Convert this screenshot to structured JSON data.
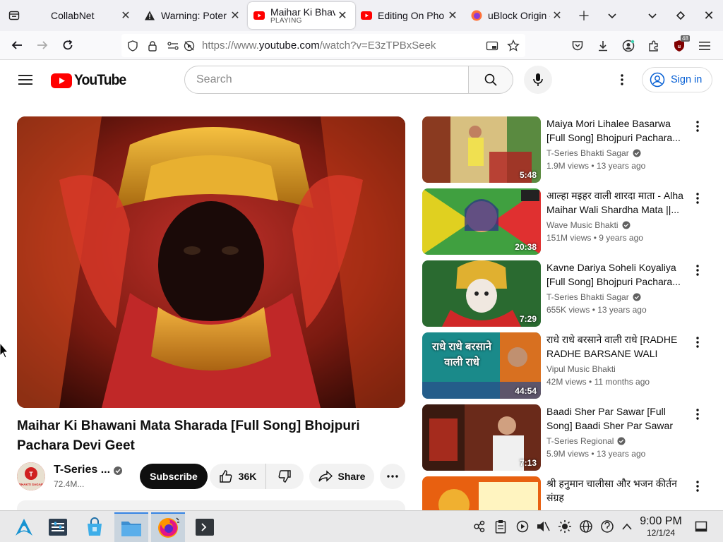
{
  "browser": {
    "tabs": [
      {
        "title": "CollabNet",
        "favicon": "blank-page-icon"
      },
      {
        "title": "Warning: Poter",
        "favicon": "warning-icon"
      },
      {
        "title": "Maihar Ki Bhav",
        "subtitle": "PLAYING",
        "favicon": "youtube-icon",
        "active": true
      },
      {
        "title": "Editing On Pho",
        "favicon": "youtube-icon"
      },
      {
        "title": "uBlock Origin -",
        "favicon": "firefox-icon"
      }
    ],
    "url_prefix": "https://www.",
    "url_domain": "youtube.com",
    "url_path": "/watch?v=E3zTPBxSeek",
    "extension_badge": "48"
  },
  "youtube": {
    "logo_text": "YouTube",
    "search_placeholder": "Search",
    "sign_in_label": "Sign in",
    "video": {
      "title": "Maihar Ki Bhawani Mata Sharada [Full Song] Bhojpuri Pachara Devi Geet",
      "channel": "T-Series ...",
      "subscribers": "72.4M...",
      "avatar_text": "BHAKTI SAGAR",
      "subscribe_label": "Subscribe",
      "likes": "36K",
      "share_label": "Share"
    },
    "recommendations": [
      {
        "title": "Maiya Mori Lihalee Basarwa [Full Song] Bhojpuri Pachara...",
        "channel": "T-Series Bhakti Sagar",
        "verified": true,
        "views": "1.9M views",
        "age": "13 years ago",
        "duration": "5:48"
      },
      {
        "title": "आल्हा मइहर वाली शारदा माता - Alha Maihar Wali Shardha Mata ||...",
        "channel": "Wave Music Bhakti",
        "verified": true,
        "views": "151M views",
        "age": "9 years ago",
        "duration": "20:38"
      },
      {
        "title": "Kavne Dariya Soheli Koyaliya [Full Song] Bhojpuri Pachara...",
        "channel": "T-Series Bhakti Sagar",
        "verified": true,
        "views": "655K views",
        "age": "13 years ago",
        "duration": "7:29"
      },
      {
        "title": "राधे राधे बरसाने वाली राधे [RADHE RADHE BARSANE WALI RADH...",
        "channel": "Vipul Music Bhakti",
        "verified": false,
        "views": "42M views",
        "age": "11 months ago",
        "duration": "44:54",
        "thumb_text": "राधे राधे बरसाने वाली राधे"
      },
      {
        "title": "Baadi Sher Par Sawar [Full Song] Baadi Sher Par Sawar",
        "channel": "T-Series Regional",
        "verified": true,
        "views": "5.9M views",
        "age": "13 years ago",
        "duration": "7:13"
      },
      {
        "title": "श्री हनुमान चालीसा और भजन कीर्तन संग्रह",
        "channel": "",
        "verified": false,
        "views": "",
        "age": "",
        "duration": ""
      }
    ]
  },
  "taskbar": {
    "time": "9:00 PM",
    "date": "12/1/24"
  },
  "colors": {
    "youtube_red": "#ff0000",
    "link_blue": "#065fd4",
    "taskbar_bg": "#e9e9ea"
  }
}
